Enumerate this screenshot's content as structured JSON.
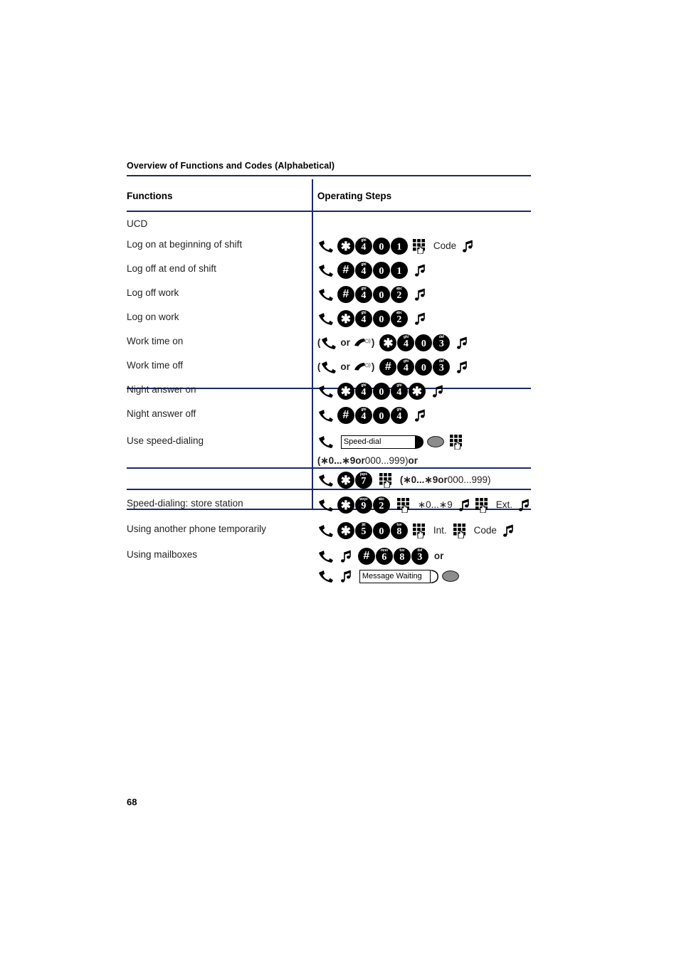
{
  "document": {
    "section_header": "Overview of Functions and Codes (Alphabetical)",
    "page_number": "68"
  },
  "table": {
    "columns": {
      "functions": "Functions",
      "operating_steps": "Operating Steps"
    },
    "group_title": "UCD",
    "rows": [
      {
        "function": "Log on at beginning of shift",
        "steps_text": "lift-handset * 4(ghi) 0 1 keypad Code tone"
      },
      {
        "function": "Log off at end of shift",
        "steps_text": "lift-handset # 4(ghi) 0 1 tone"
      },
      {
        "function": "Log off work",
        "steps_text": "lift-handset # 4(ghi) 0 2(abc) tone"
      },
      {
        "function": "Log on work",
        "steps_text": "lift-handset * 4(ghi) 0 2(abc) tone"
      },
      {
        "function": "Work time on",
        "steps_text": "( lift-handset or speaker ) * 4(ghi) 0 3(def) tone"
      },
      {
        "function": "Work time off",
        "steps_text": "( lift-handset or speaker ) # 4(ghi) 0 3(def) tone"
      },
      {
        "function": "Night answer on",
        "steps_text": "lift-handset * 4(ghi) 0 4(ghi) * tone"
      },
      {
        "function": "Night answer off",
        "steps_text": "lift-handset # 4(ghi) 0 4(ghi) tone"
      },
      {
        "function": "Use speed-dialing",
        "steps_text": "lift-handset [Speed-dial] LED keypad / (*0...*9 or 000...999) or / lift-handset * 7(pqrs) keypad (*0...*9 or 000...999)"
      },
      {
        "function": "Speed-dialing: store station",
        "steps_text": "lift-handset * 9(wxyz) 2(abc) keypad *0...*9 tone keypad Ext. tone"
      },
      {
        "function": "Using another phone temporarily",
        "steps_text": "lift-handset * 5(jkl) 0 8(tuv) keypad Int. keypad Code tone"
      },
      {
        "function": "Using mailboxes",
        "steps_text": "lift-handset tone # 6(mno) 8(tuv) 3(def) or / lift-handset tone [Message Waiting] LED"
      }
    ],
    "labels": {
      "or": "or",
      "code": "Code",
      "ext": "Ext.",
      "int": "Int.",
      "speed_dial_key": "Speed-dial",
      "message_waiting_key": "Message Waiting",
      "speed_dial_range": "(∗0...∗9 ",
      "speed_dial_range_or": "or",
      "speed_dial_range_2": " 000...999) ",
      "speed_dial_range_end_or": "or",
      "inline_range_open": "(∗0...∗9 ",
      "inline_range_mid": "or",
      "inline_range_close": " 000...999)",
      "store_range": "∗0...∗9"
    },
    "keys": {
      "star": "✱",
      "hash": "#",
      "zero": "0",
      "one": "1",
      "two": "2",
      "three": "3",
      "four": "4",
      "five": "5",
      "six": "6",
      "seven": "7",
      "eight": "8",
      "nine": "9",
      "sub_two": "abc",
      "sub_three": "def",
      "sub_four": "ghi",
      "sub_five": "jkl",
      "sub_six": "mno",
      "sub_seven": "pqrs",
      "sub_eight": "tuv",
      "sub_nine": "wxyz"
    }
  },
  "colors": {
    "rule": "#1a2a6c",
    "text": "#231f20",
    "key_fill": "#000000",
    "led_fill": "#8c8c8c"
  }
}
